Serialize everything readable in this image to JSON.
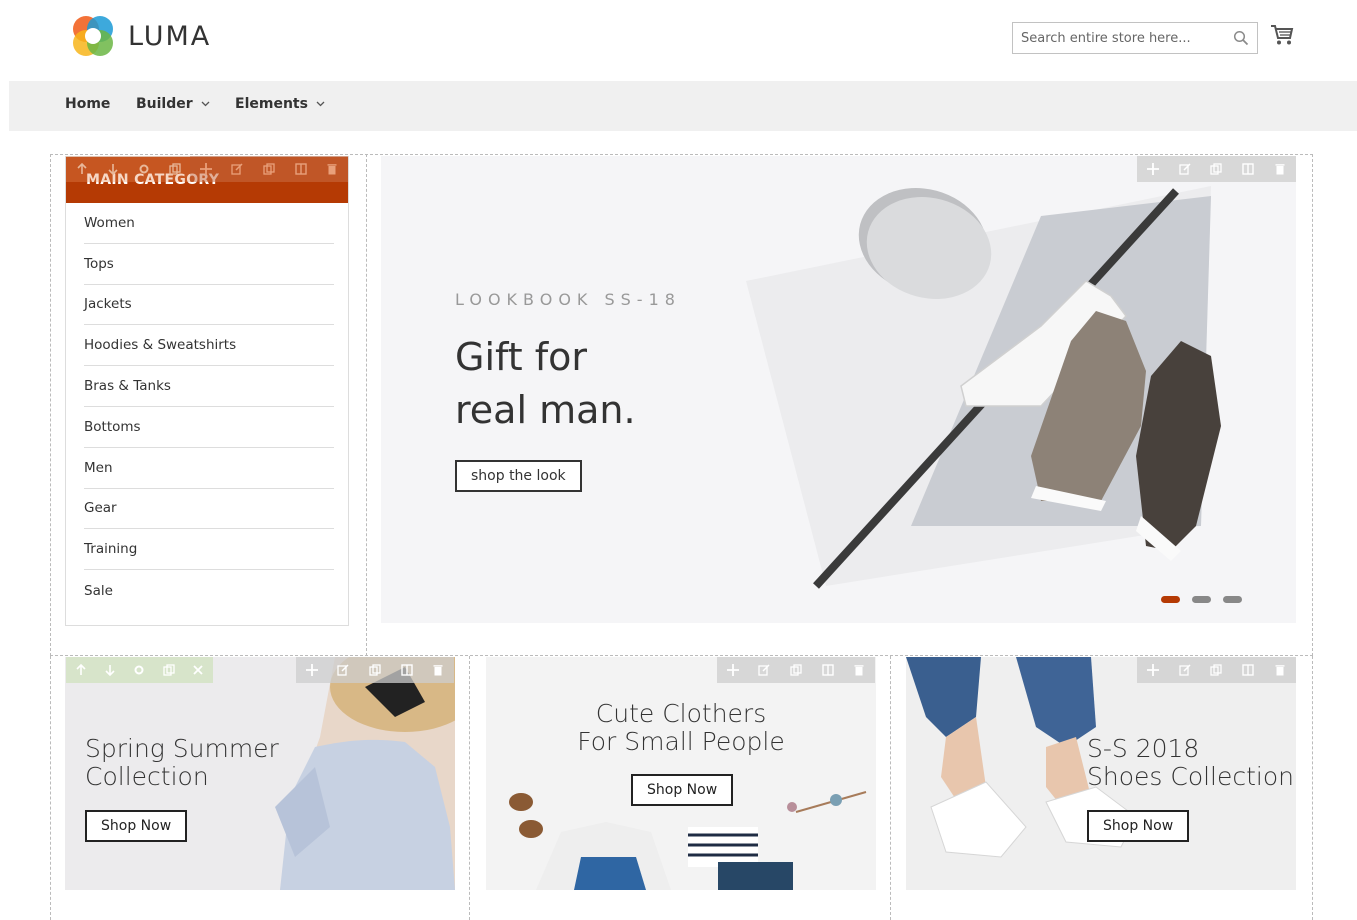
{
  "brand": {
    "name": "LUMA"
  },
  "search": {
    "placeholder": "Search entire store here..."
  },
  "nav": {
    "items": [
      {
        "label": "Home",
        "dropdown": false
      },
      {
        "label": "Builder",
        "dropdown": true
      },
      {
        "label": "Elements",
        "dropdown": true
      }
    ]
  },
  "category": {
    "title": "MAIN CATEGORY",
    "items": [
      "Women",
      "Tops",
      "Jackets",
      "Hoodies & Sweatshirts",
      "Bras & Tanks",
      "Bottoms",
      "Men",
      "Gear",
      "Training",
      "Sale"
    ]
  },
  "hero": {
    "eyebrow": "LOOKBOOK SS-18",
    "title_line1": "Gift for",
    "title_line2": "real man.",
    "button": "shop the look",
    "slides_total": 3,
    "active_slide": 1
  },
  "promos": [
    {
      "title_line1": "Spring Summer",
      "title_line2": "Collection",
      "button": "Shop Now"
    },
    {
      "title_line1": "Cute Clothers",
      "title_line2": "For Small People",
      "button": "Shop Now"
    },
    {
      "title_line1": "S-S 2018",
      "title_line2": "Shoes Collection",
      "button": "Shop Now"
    }
  ],
  "colors": {
    "accent": "#b53a04",
    "nav_bg": "#f0f0f0",
    "banner_bg": "#f5f5f7"
  },
  "icons": {
    "search": "search-icon",
    "cart": "cart-icon",
    "toolbar": [
      "move-icon",
      "edit-icon",
      "duplicate-icon",
      "columns-icon",
      "delete-icon"
    ],
    "row_toolbar": [
      "arrow-up-icon",
      "arrow-down-icon",
      "gear-icon",
      "duplicate-icon",
      "close-icon"
    ]
  }
}
